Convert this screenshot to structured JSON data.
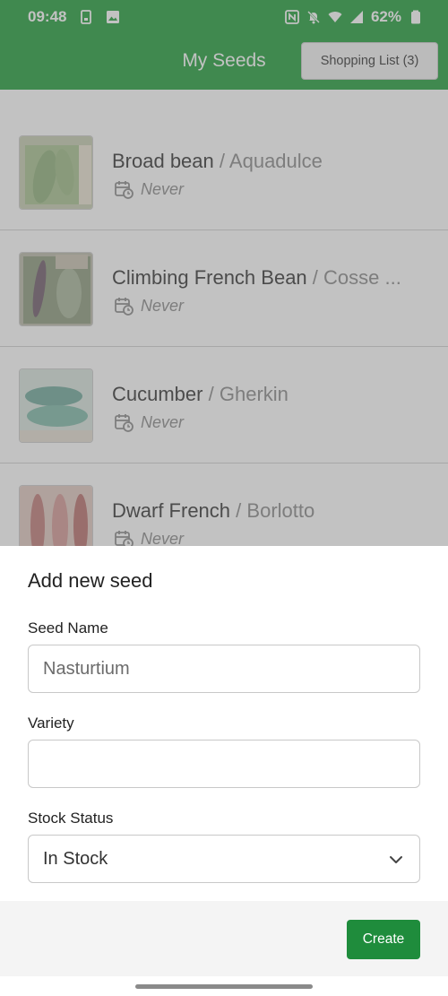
{
  "status_bar": {
    "time": "09:48",
    "battery": "62%",
    "icons": [
      "sim-icon",
      "image-icon",
      "nfc-icon",
      "mute-icon",
      "wifi-icon",
      "signal-icon",
      "battery-icon"
    ]
  },
  "app_bar": {
    "title": "My Seeds",
    "shopping_list_label": "Shopping List (3)"
  },
  "seeds": [
    {
      "name": "Broad bean",
      "separator": "/",
      "variety": "Aquadulce",
      "last_sown": "Never",
      "thumb_color": "#a8c290"
    },
    {
      "name": "Climbing French Bean",
      "separator": "/",
      "variety": "Cosse ...",
      "last_sown": "Never",
      "thumb_color": "#8c9a7c"
    },
    {
      "name": "Cucumber",
      "separator": "/",
      "variety": "Gherkin",
      "last_sown": "Never",
      "thumb_color": "#8fc4b8"
    },
    {
      "name": "Dwarf French",
      "separator": "/",
      "variety": "Borlotto",
      "last_sown": "Never",
      "thumb_color": "#d0a0a0"
    }
  ],
  "sheet": {
    "title": "Add new seed",
    "seed_name_label": "Seed Name",
    "seed_name_placeholder": "Nasturtium",
    "variety_label": "Variety",
    "variety_value": "",
    "stock_label": "Stock Status",
    "stock_value": "In Stock",
    "create_label": "Create"
  },
  "colors": {
    "brand_green": "#1f9e3a",
    "button_green": "#1f8c3c"
  }
}
